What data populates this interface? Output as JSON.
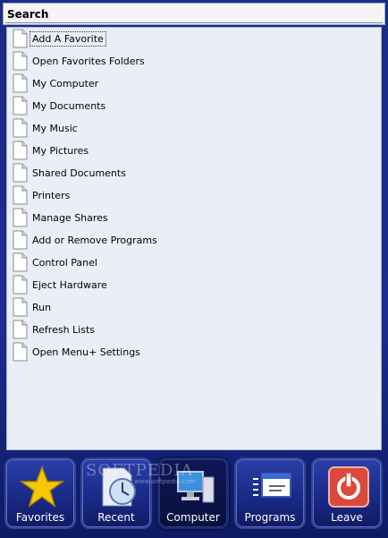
{
  "search": {
    "label": "Search",
    "value": "",
    "placeholder": ""
  },
  "list": {
    "items": [
      {
        "label": "Add A Favorite",
        "icon": "document-icon",
        "selected": true
      },
      {
        "label": "Open Favorites Folders",
        "icon": "document-icon"
      },
      {
        "label": "My Computer",
        "icon": "document-icon"
      },
      {
        "label": "My Documents",
        "icon": "document-icon"
      },
      {
        "label": "My Music",
        "icon": "document-icon"
      },
      {
        "label": "My Pictures",
        "icon": "document-icon"
      },
      {
        "label": "Shared Documents",
        "icon": "document-icon"
      },
      {
        "label": "Printers",
        "icon": "document-icon"
      },
      {
        "label": "Manage Shares",
        "icon": "document-icon"
      },
      {
        "label": "Add or Remove Programs",
        "icon": "document-icon"
      },
      {
        "label": "Control Panel",
        "icon": "document-icon"
      },
      {
        "label": "Eject Hardware",
        "icon": "document-icon"
      },
      {
        "label": "Run",
        "icon": "document-icon"
      },
      {
        "label": "Refresh Lists",
        "icon": "document-icon"
      },
      {
        "label": "Open Menu+ Settings",
        "icon": "document-icon"
      }
    ]
  },
  "tabs": [
    {
      "label": "Favorites",
      "icon": "star-icon",
      "active": false
    },
    {
      "label": "Recent",
      "icon": "clock-document-icon",
      "active": false
    },
    {
      "label": "Computer",
      "icon": "computer-icon",
      "active": true
    },
    {
      "label": "Programs",
      "icon": "window-list-icon",
      "active": false
    },
    {
      "label": "Leave",
      "icon": "power-icon",
      "active": false
    }
  ],
  "watermark": {
    "text": "SOFTPEDIA",
    "sub": "www.softpedia.com"
  },
  "colors": {
    "background": "#1d2f8c",
    "panel": "#eaeff7",
    "star": "#f6c800",
    "power": "#d94a3a"
  }
}
